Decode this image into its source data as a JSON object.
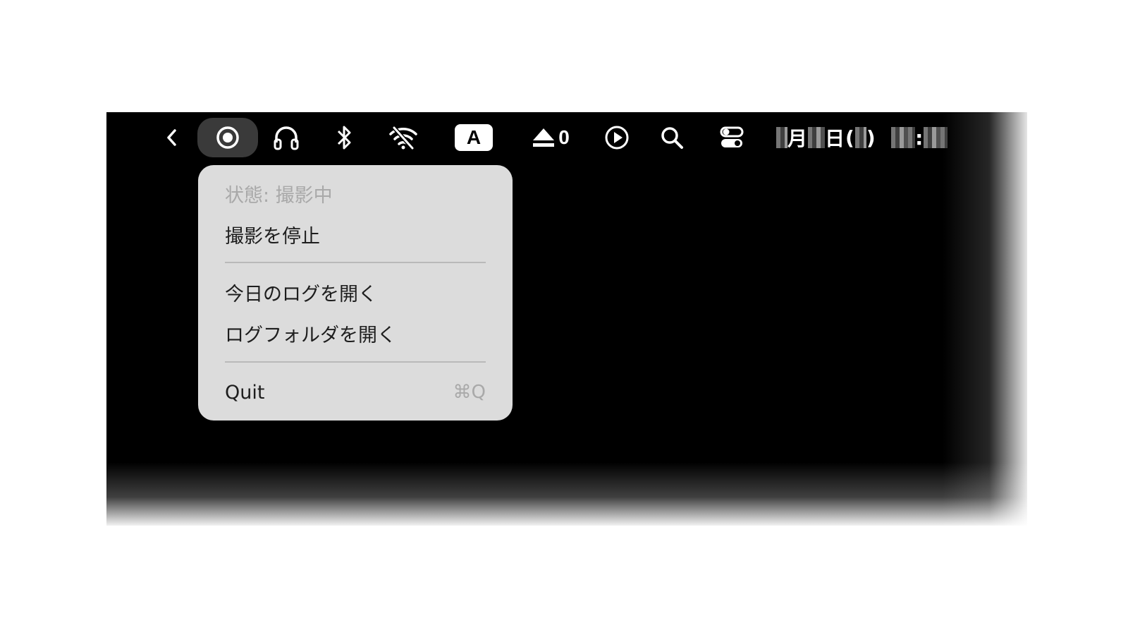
{
  "menubar": {
    "items": [
      {
        "name": "back-chevron",
        "icon": "chevron-left-icon"
      },
      {
        "name": "recording-status",
        "icon": "record-circle-icon",
        "active": true
      },
      {
        "name": "headphones",
        "icon": "headphones-icon"
      },
      {
        "name": "bluetooth",
        "icon": "bluetooth-icon"
      },
      {
        "name": "wifi",
        "icon": "wifi-off-icon"
      },
      {
        "name": "input-source",
        "icon": "input-source-badge",
        "label": "A"
      },
      {
        "name": "eject",
        "icon": "eject-icon",
        "count": "0"
      },
      {
        "name": "now-playing",
        "icon": "play-circle-icon"
      },
      {
        "name": "spotlight",
        "icon": "search-icon"
      },
      {
        "name": "control-center",
        "icon": "toggle-switches-icon"
      }
    ],
    "clock": {
      "month_suffix": "月",
      "day_suffix": "日",
      "open_paren": "(",
      "close_paren": ")",
      "time_sep": ":"
    }
  },
  "menu": {
    "status_label": "状態: 撮影中",
    "stop_capture_label": "撮影を停止",
    "open_today_log_label": "今日のログを開く",
    "open_log_folder_label": "ログフォルダを開く",
    "quit_label": "Quit",
    "quit_shortcut": "⌘Q"
  },
  "colors": {
    "menubar_bg": "#000000",
    "menu_bg": "#dcdcdc",
    "menu_text": "#1e1e1e",
    "menu_disabled_text": "#a9a9a9",
    "active_item_bg": "#3a3a3a"
  }
}
